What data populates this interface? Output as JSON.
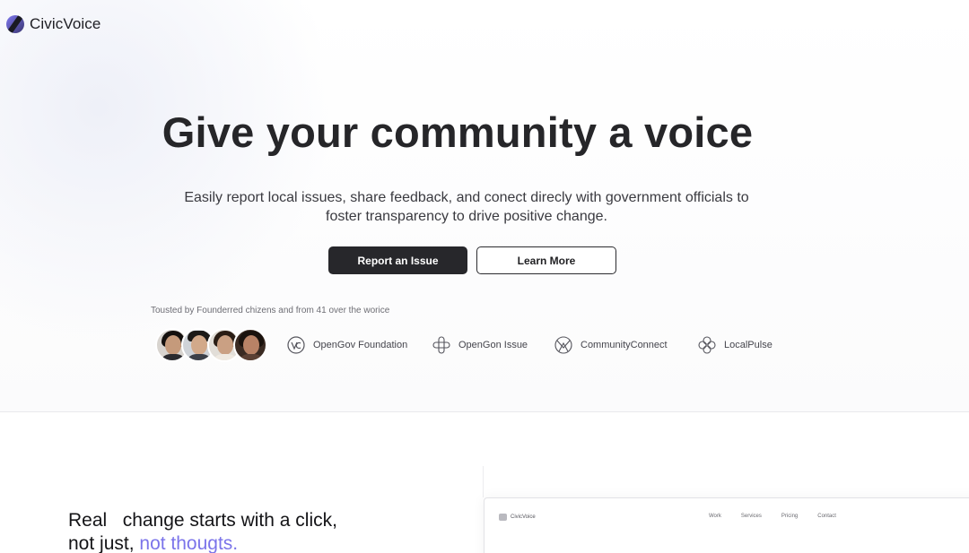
{
  "brand": {
    "name": "CivicVoice"
  },
  "hero": {
    "title": "Give your community a voice",
    "subtitle": "Easily report local issues, share feedback, and conect direcly with government officials to foster transparency to drive positive change.",
    "primary_button": "Report an Issue",
    "secondary_button": "Learn More",
    "trusted_text": "Tousted by Founderred chizens and from 41 over the worice"
  },
  "partners": [
    {
      "name": "OpenGov Foundation",
      "icon": "opengov-logo-icon"
    },
    {
      "name": "OpenGon Issue",
      "icon": "opengon-logo-icon"
    },
    {
      "name": "CommunityConnect",
      "icon": "communityconnect-logo-icon"
    },
    {
      "name": "LocalPulse",
      "icon": "localpulse-logo-icon"
    }
  ],
  "section2": {
    "title_line1": "Real   change starts with a click,",
    "title_line2_prefix": "not just, ",
    "title_line2_accent": "not thougts."
  },
  "mock": {
    "brand": "CivicVoice",
    "nav": [
      "Work",
      "Services",
      "Pricing",
      "Contact"
    ]
  },
  "colors": {
    "accent": "#7b74ea",
    "primary_button": "#27272b",
    "text_dark": "#262629"
  }
}
